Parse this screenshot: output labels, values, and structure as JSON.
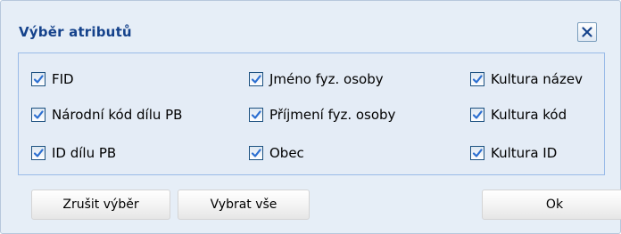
{
  "dialog": {
    "title": "Výběr atributů",
    "close_icon": "close-x-icon",
    "accent_color": "#15428b",
    "check_color": "#2c6fd1"
  },
  "attributes": [
    {
      "label": "FID",
      "checked": true
    },
    {
      "label": "Národní kód dílu PB",
      "checked": true
    },
    {
      "label": "ID dílu PB",
      "checked": true
    },
    {
      "label": "Jméno fyz. osoby",
      "checked": true
    },
    {
      "label": "Příjmení fyz. osoby",
      "checked": true
    },
    {
      "label": "Obec",
      "checked": true
    },
    {
      "label": "Kultura název",
      "checked": true
    },
    {
      "label": "Kultura kód",
      "checked": true
    },
    {
      "label": "Kultura ID",
      "checked": true
    }
  ],
  "buttons": {
    "clear": "Zrušit výběr",
    "select_all": "Vybrat vše",
    "ok": "Ok"
  }
}
